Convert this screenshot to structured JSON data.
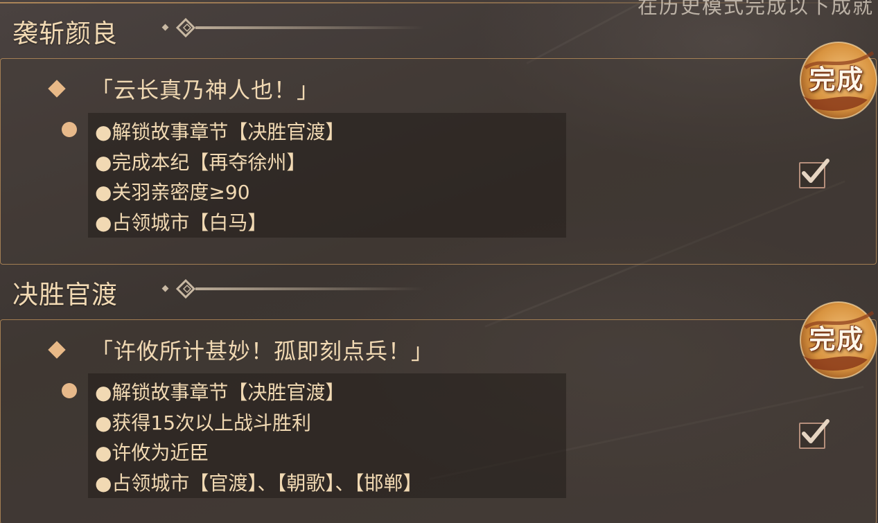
{
  "header_note": "在历史模式完成以下成就",
  "badge_label": "完成",
  "sections": [
    {
      "title": "袭斩颜良",
      "quote": "「云长真乃神人也！」",
      "conditions": [
        "●解锁故事章节【决胜官渡】",
        "●完成本纪【再夺徐州】",
        "●关羽亲密度≥90",
        "●占领城市【白马】"
      ],
      "checked": true
    },
    {
      "title": "决胜官渡",
      "quote": "「许攸所计甚妙！孤即刻点兵！」",
      "conditions": [
        "●解锁故事章节【决胜官渡】",
        "●获得15次以上战斗胜利",
        "●许攸为近臣",
        "●占领城市【官渡】、【朝歌】、【邯郸】"
      ],
      "checked": true
    }
  ],
  "colors": {
    "title": "#f1d9b3",
    "border": "#c4965f",
    "diamond": "#e8b987",
    "badge": "#d8933f"
  }
}
